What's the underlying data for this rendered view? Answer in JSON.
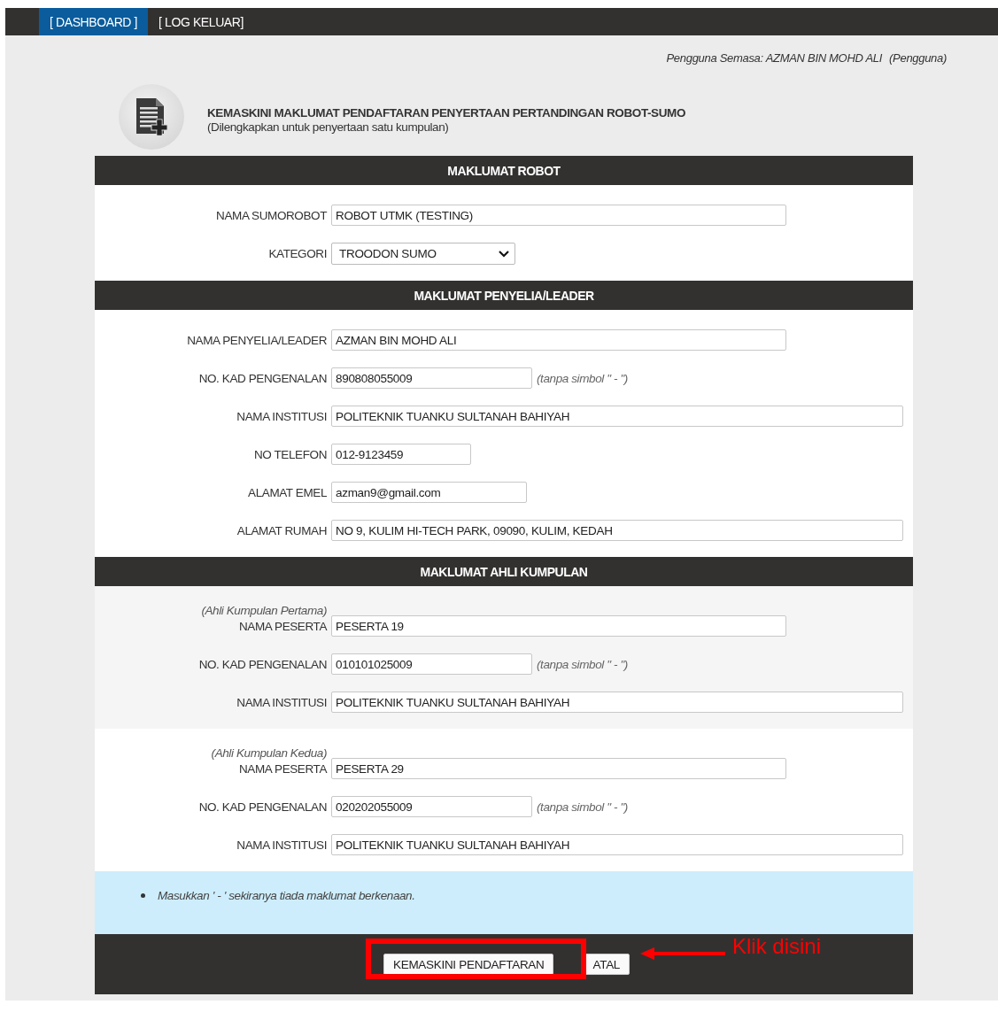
{
  "nav": [
    {
      "label": "[ DASHBOARD ]",
      "selected": true
    },
    {
      "label": "[ LOG KELUAR]",
      "selected": false
    }
  ],
  "current_user": {
    "label": "Pengguna Semasa: AZMAN BIN MOHD ALI",
    "role": "(Pengguna)"
  },
  "page_header": {
    "title": "KEMASKINI MAKLUMAT PENDAFTARAN PENYERTAAN PERTANDINGAN ROBOT-SUMO",
    "subtitle": "(Dilengkapkan untuk penyertaan satu kumpulan)"
  },
  "sections": [
    {
      "title": "MAKLUMAT ROBOT",
      "groups": [
        {
          "rows": [
            {
              "label": "NAMA SUMOROBOT",
              "value": "ROBOT UTMK (TESTING)",
              "kind": "name"
            },
            {
              "label": "KATEGORI",
              "value": "TROODON SUMO",
              "kind": "select"
            }
          ]
        }
      ]
    },
    {
      "title": "MAKLUMAT PENYELIA/LEADER",
      "groups": [
        {
          "rows": [
            {
              "label": "NAMA PENYELIA/LEADER",
              "value": "AZMAN BIN MOHD ALI",
              "kind": "name"
            },
            {
              "label": "NO. KAD PENGENALAN",
              "value": "890808055009",
              "kind": "ic",
              "hint": "(tanpa simbol \" - \")"
            },
            {
              "label": "NAMA INSTITUSI",
              "value": "POLITEKNIK TUANKU SULTANAH BAHIYAH",
              "kind": "wide"
            },
            {
              "label": "NO TELEFON",
              "value": "012-9123459",
              "kind": "phone"
            },
            {
              "label": "ALAMAT EMEL",
              "value": "azman9@gmail.com",
              "kind": "email"
            },
            {
              "label": "ALAMAT RUMAH",
              "value": "NO 9, KULIM HI-TECH PARK, 09090, KULIM, KEDAH",
              "kind": "wide"
            }
          ]
        }
      ]
    },
    {
      "title": "MAKLUMAT AHLI KUMPULAN",
      "groups": [
        {
          "caption": "(Ahli Kumpulan Pertama)",
          "rows": [
            {
              "label": "NAMA PESERTA",
              "value": "PESERTA 19",
              "kind": "name"
            },
            {
              "label": "NO. KAD PENGENALAN",
              "value": "010101025009",
              "kind": "ic",
              "hint": "(tanpa simbol \" - \")"
            },
            {
              "label": "NAMA INSTITUSI",
              "value": "POLITEKNIK TUANKU SULTANAH BAHIYAH",
              "kind": "wide"
            }
          ]
        },
        {
          "caption": "(Ahli Kumpulan Kedua)",
          "rows": [
            {
              "label": "NAMA PESERTA",
              "value": "PESERTA 29",
              "kind": "name"
            },
            {
              "label": "NO. KAD PENGENALAN",
              "value": "020202055009",
              "kind": "ic",
              "hint": "(tanpa simbol \" - \")"
            },
            {
              "label": "NAMA INSTITUSI",
              "value": "POLITEKNIK TUANKU SULTANAH BAHIYAH",
              "kind": "wide"
            }
          ]
        }
      ]
    }
  ],
  "notes": [
    "Masukkan ' - ' sekiranya tiada maklumat berkenaan."
  ],
  "buttons": [
    "KEMASKINI PENDAFTARAN",
    "ATAL"
  ],
  "annotation": {
    "text": "Klik disini"
  }
}
